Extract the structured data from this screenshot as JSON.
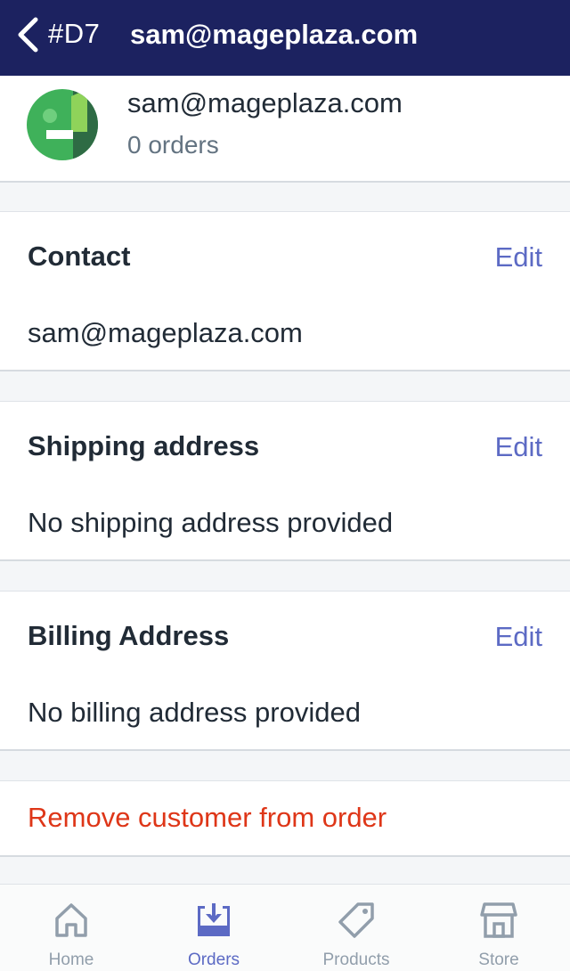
{
  "nav": {
    "order_number": "#D7",
    "title": "sam@mageplaza.com"
  },
  "customer": {
    "email": "sam@mageplaza.com",
    "orders": "0 orders"
  },
  "contact": {
    "title": "Contact",
    "edit": "Edit",
    "value": "sam@mageplaza.com"
  },
  "shipping": {
    "title": "Shipping address",
    "edit": "Edit",
    "value": "No shipping address provided"
  },
  "billing": {
    "title": "Billing Address",
    "edit": "Edit",
    "value": "No billing address provided"
  },
  "remove": {
    "label": "Remove customer from order"
  },
  "tabs": [
    {
      "label": "Home",
      "icon": "home-icon"
    },
    {
      "label": "Orders",
      "icon": "orders-icon"
    },
    {
      "label": "Products",
      "icon": "tag-icon"
    },
    {
      "label": "Store",
      "icon": "store-icon"
    }
  ],
  "colors": {
    "nav_bg": "#1c2260",
    "accent": "#5c6ac4",
    "destructive": "#de3618",
    "muted": "#637381"
  }
}
